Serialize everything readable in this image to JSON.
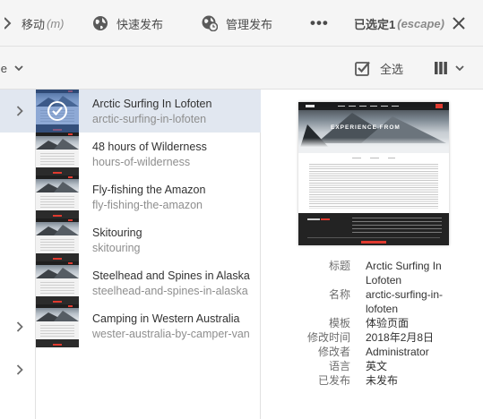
{
  "actionbar": {
    "move_label": "移动",
    "move_shortcut": "(m)",
    "quick_publish_label": "快速发布",
    "manage_publish_label": "管理发布",
    "more_label": "•••",
    "selected_label": "已选定1",
    "selected_shortcut": "(escape)",
    "icons": {
      "move": "move-arrows-icon",
      "quick_publish": "globe-icon",
      "manage_publish": "globe-clock-icon",
      "more": "more-icon",
      "close": "close-icon"
    }
  },
  "toolbar": {
    "left_label": "e",
    "select_all_label": "全选",
    "icons": {
      "select_all": "select-all-checkbox-icon",
      "view": "column-view-icon",
      "dropdown": "chevron-down-icon"
    }
  },
  "list": {
    "items": [
      {
        "title": "Arctic Surfing In Lofoten",
        "name": "arctic-surfing-in-lofoten",
        "selected": true
      },
      {
        "title": "48 hours of Wilderness",
        "name": "hours-of-wilderness",
        "selected": false
      },
      {
        "title": "Fly-fishing the Amazon",
        "name": "fly-fishing-the-amazon",
        "selected": false
      },
      {
        "title": "Skitouring",
        "name": "skitouring",
        "selected": false
      },
      {
        "title": "Steelhead and Spines in Alaska",
        "name": "steelhead-and-spines-in-alaska",
        "selected": false
      },
      {
        "title": "Camping in Western Australia",
        "name": "wester-australia-by-camper-van",
        "selected": false
      }
    ]
  },
  "preview": {
    "hero_text": "EXPERIENCE FROM"
  },
  "meta": {
    "title_key": "标题",
    "title_value": "Arctic Surfing In Lofoten",
    "name_key": "名称",
    "name_value": "arctic-surfing-in-lofoten",
    "template_key": "模板",
    "template_value": "体验页面",
    "modified_key": "修改时间",
    "modified_value": "2018年2月8日",
    "modifier_key": "修改者",
    "modifier_value": "Administrator",
    "language_key": "语言",
    "language_value": "英文",
    "published_key": "已发布",
    "published_value": "未发布"
  },
  "colors": {
    "selected_row": "#e1e7f0",
    "toolbar_bg": "#f5f5f5",
    "accent_red": "#e03a2f",
    "text_dark": "#323232",
    "text_muted": "#8e8e8e"
  }
}
